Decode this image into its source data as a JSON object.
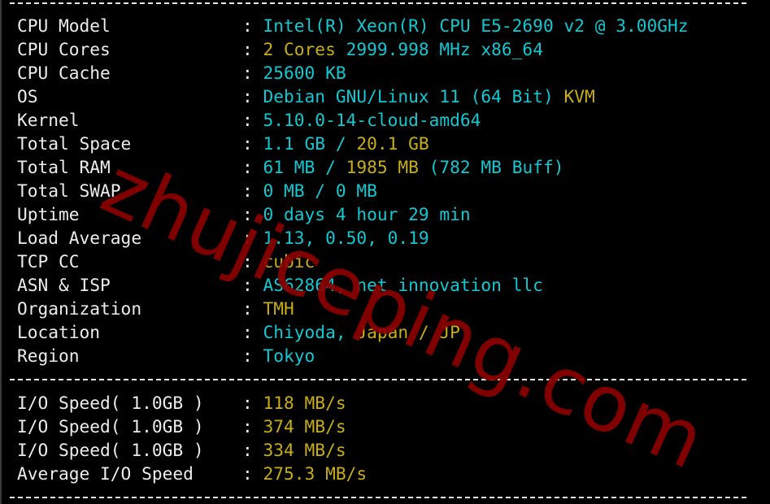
{
  "colors": {
    "background": "#000000",
    "label": "#ececec",
    "value_cyan": "#12c8d2",
    "value_yellow": "#c8ae14",
    "watermark": "#8b0000"
  },
  "separator": ":",
  "system_info": [
    {
      "label": "CPU Model",
      "parts": [
        {
          "text": "Intel(R) Xeon(R) CPU E5-2690 v2 @ 3.00GHz",
          "color": "cyan"
        }
      ]
    },
    {
      "label": "CPU Cores",
      "parts": [
        {
          "text": "2 Cores",
          "color": "yellow"
        },
        {
          "text": " 2999.998 MHz x86_64",
          "color": "cyan"
        }
      ]
    },
    {
      "label": "CPU Cache",
      "parts": [
        {
          "text": "25600 KB",
          "color": "cyan"
        }
      ]
    },
    {
      "label": "OS",
      "parts": [
        {
          "text": "Debian GNU/Linux 11 (64 Bit)",
          "color": "cyan"
        },
        {
          "text": " KVM",
          "color": "yellow"
        }
      ]
    },
    {
      "label": "Kernel",
      "parts": [
        {
          "text": "5.10.0-14-cloud-amd64",
          "color": "cyan"
        }
      ]
    },
    {
      "label": "Total Space",
      "parts": [
        {
          "text": "1.1 GB / ",
          "color": "cyan"
        },
        {
          "text": "20.1 GB",
          "color": "yellow"
        }
      ]
    },
    {
      "label": "Total RAM",
      "parts": [
        {
          "text": "61 MB / ",
          "color": "cyan"
        },
        {
          "text": "1985 MB",
          "color": "yellow"
        },
        {
          "text": " (782 MB Buff)",
          "color": "cyan"
        }
      ]
    },
    {
      "label": "Total SWAP",
      "parts": [
        {
          "text": "0 MB / 0 MB",
          "color": "cyan"
        }
      ]
    },
    {
      "label": "Uptime",
      "parts": [
        {
          "text": "0 days 4 hour 29 min",
          "color": "cyan"
        }
      ]
    },
    {
      "label": "Load Average",
      "parts": [
        {
          "text": "1.13, 0.50, 0.19",
          "color": "cyan"
        }
      ]
    },
    {
      "label": "TCP CC",
      "parts": [
        {
          "text": "cubic",
          "color": "yellow"
        }
      ]
    },
    {
      "label": "ASN & ISP",
      "parts": [
        {
          "text": "AS62864, net innovation llc",
          "color": "cyan"
        }
      ]
    },
    {
      "label": "Organization",
      "parts": [
        {
          "text": "TMH",
          "color": "yellow"
        }
      ]
    },
    {
      "label": "Location",
      "parts": [
        {
          "text": "Chiyoda, ",
          "color": "cyan"
        },
        {
          "text": "Japan / JP",
          "color": "yellow"
        }
      ]
    },
    {
      "label": "Region",
      "parts": [
        {
          "text": "Tokyo",
          "color": "cyan"
        }
      ]
    }
  ],
  "io_info": [
    {
      "label": "I/O Speed( 1.0GB )",
      "parts": [
        {
          "text": "118 MB/s",
          "color": "yellow"
        }
      ]
    },
    {
      "label": "I/O Speed( 1.0GB )",
      "parts": [
        {
          "text": "374 MB/s",
          "color": "yellow"
        }
      ]
    },
    {
      "label": "I/O Speed( 1.0GB )",
      "parts": [
        {
          "text": "334 MB/s",
          "color": "yellow"
        }
      ]
    },
    {
      "label": "Average I/O Speed",
      "parts": [
        {
          "text": "275.3 MB/s",
          "color": "yellow"
        }
      ]
    }
  ],
  "watermark": "zhujiceping.com"
}
